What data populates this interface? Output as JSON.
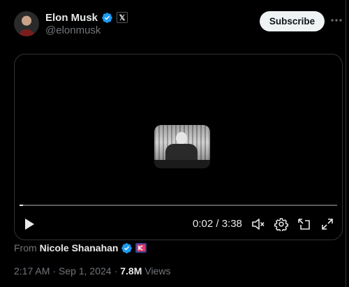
{
  "author": {
    "display_name": "Elon Musk",
    "handle": "@elonmusk",
    "x_badge": "𝕏"
  },
  "actions": {
    "subscribe_label": "Subscribe"
  },
  "video": {
    "time_display": "0:02 / 3:38",
    "progress_fraction": 0.01
  },
  "attribution": {
    "from_label": "From",
    "source_name": "Nicole Shanahan"
  },
  "meta": {
    "time": "2:17 AM",
    "separator1": "·",
    "date": "Sep 1, 2024",
    "separator2": "·",
    "views_count": "7.8M",
    "views_label": "Views"
  },
  "colors": {
    "verified_blue": "#1d9bf0",
    "background": "#000000",
    "muted_text": "#71767b"
  }
}
